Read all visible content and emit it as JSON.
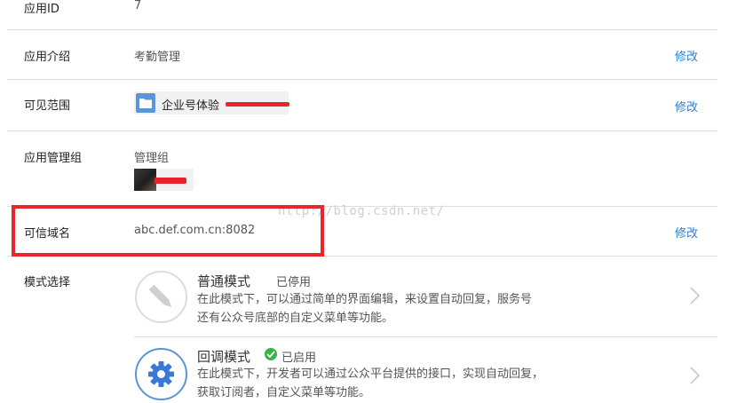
{
  "rows": {
    "app_id": {
      "label": "应用ID",
      "value": "7"
    },
    "app_intro": {
      "label": "应用介绍",
      "value": "考勤管理",
      "edit": "修改"
    },
    "visibility": {
      "label": "可见范围",
      "value": "企业号体验",
      "edit": "修改"
    },
    "admin_group": {
      "label": "应用管理组",
      "value": "管理组"
    },
    "trusted_domain": {
      "label": "可信域名",
      "value": "abc.def.com.cn:8082",
      "edit": "修改"
    },
    "mode_select": {
      "label": "模式选择"
    }
  },
  "modes": [
    {
      "title": "普通模式",
      "status": "已停用",
      "desc_line1": "在此模式下，可以通过简单的界面编辑，来设置自动回复，服务号",
      "desc_line2": "还有公众号底部的自定义菜单等功能。",
      "icon": "pencil-icon"
    },
    {
      "title": "回调模式",
      "status": "已启用",
      "desc_line1": "在此模式下，开发者可以通过公众平台提供的接口，实现自动回复，",
      "desc_line2": "获取订阅者，自定义菜单等功能。",
      "icon": "gear-icon"
    }
  ],
  "watermark": "http://blog.csdn.net/",
  "colors": {
    "link": "#2f80d8",
    "highlight": "#e8262d",
    "redaction": "#e8242b",
    "folder": "#5b95d8",
    "enabled": "#3bb243"
  }
}
